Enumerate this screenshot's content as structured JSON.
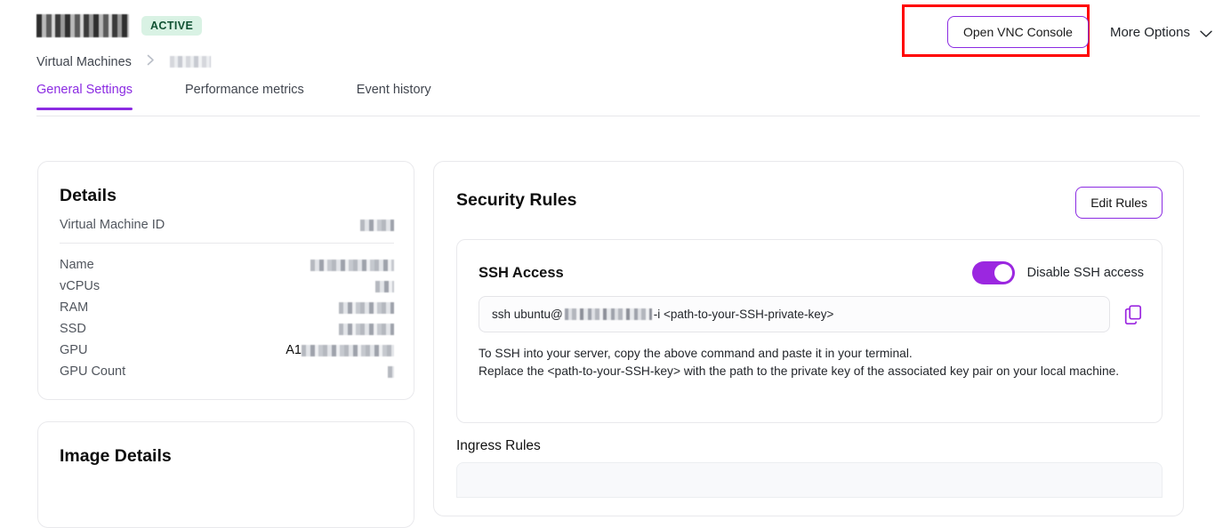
{
  "header": {
    "page_title": "[redacted]",
    "status_badge": "ACTIVE",
    "breadcrumb": {
      "root": "Virtual Machines",
      "separator": "›",
      "current": "[redacted]"
    },
    "actions": {
      "vnc_button": "Open VNC Console",
      "more_options": "More Options"
    },
    "highlight_color": "#ff0000",
    "accent_color": "#8b2be2",
    "badge_bg": "#d9f2e4",
    "badge_fg": "#0f5132"
  },
  "tabs": [
    {
      "label": "General Settings",
      "active": true
    },
    {
      "label": "Performance metrics",
      "active": false
    },
    {
      "label": "Event history",
      "active": false
    }
  ],
  "details": {
    "title": "Details",
    "id_row": {
      "label": "Virtual Machine ID",
      "value": "[redacted]",
      "redact_width": 38
    },
    "rows": [
      {
        "label": "Name",
        "value": "[redacted]",
        "redact_width": 94
      },
      {
        "label": "vCPUs",
        "value": "[redacted]",
        "redact_width": 21
      },
      {
        "label": "RAM",
        "value": "[redacted]",
        "redact_width": 62
      },
      {
        "label": "SSD",
        "value": "[redacted]",
        "redact_width": 62
      },
      {
        "label": "GPU",
        "value": "A1",
        "suffix_redacted": true,
        "redact_width": 104
      },
      {
        "label": "GPU Count",
        "value": "[redacted]",
        "redact_width": 7
      }
    ]
  },
  "image_details": {
    "title": "Image Details"
  },
  "security": {
    "title": "Security Rules",
    "edit_button": "Edit Rules",
    "ssh": {
      "heading": "SSH Access",
      "toggle_label": "Disable SSH access",
      "toggle_on": true,
      "command_prefix": "ssh ubuntu@",
      "command_host": "[redacted]",
      "command_suffix": " -i <path-to-your-SSH-private-key>",
      "copy_icon": "copy-icon",
      "help_line_1": "To SSH into your server, copy the above command and paste it in your terminal.",
      "help_line_2": "Replace the <path-to-your-SSH-key> with the path to the private key of the associated key pair on your local machine."
    },
    "ingress": {
      "title": "Ingress Rules"
    }
  }
}
